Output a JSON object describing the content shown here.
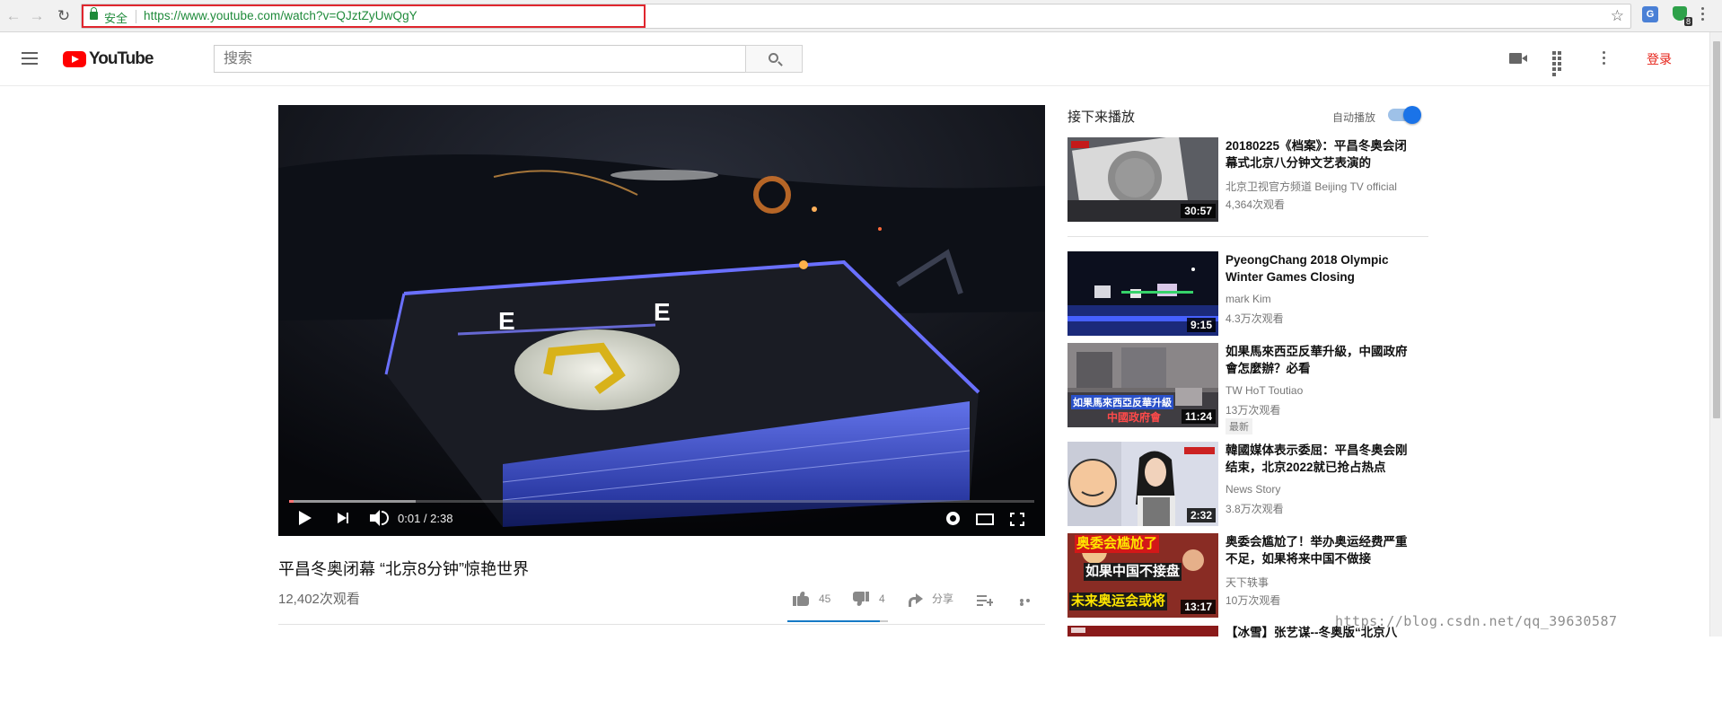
{
  "browser": {
    "secure_label": "安全",
    "url": "https://www.youtube.com/watch?v=QJztZyUwQgY",
    "extension_badge": "8"
  },
  "masthead": {
    "logo_text": "YouTube",
    "search_placeholder": "搜索",
    "signin_label": "登录"
  },
  "player": {
    "time": "0:01 / 2:38",
    "progress_played": 0.006,
    "progress_loaded": 0.17
  },
  "video": {
    "title": "平昌冬奥闭幕 “北京8分钟”惊艳世界",
    "views": "12,402次观看",
    "likes": "45",
    "dislikes": "4",
    "share_label": "分享",
    "like_ratio": 0.92
  },
  "sidebar": {
    "up_next_label": "接下来播放",
    "autoplay_label": "自动播放",
    "autoplay_on": true,
    "items": [
      {
        "title": "20180225《档案》：平昌冬奥会闭幕式北京八分钟文艺表演的",
        "channel": "北京卫视官方频道 Beijing TV official",
        "views": "4,364次观看",
        "duration": "30:57",
        "badge": ""
      },
      {
        "title": "PyeongChang 2018 Olympic Winter Games Closing",
        "channel": "mark Kim",
        "views": "4.3万次观看",
        "duration": "9:15",
        "badge": ""
      },
      {
        "title": "如果馬來西亞反華升級，中國政府會怎麼辦？必看",
        "channel": "TW HoT Toutiao",
        "views": "13万次观看",
        "duration": "11:24",
        "badge": "最新",
        "thumb_caption_1": "如果馬來西亞反華升級",
        "thumb_caption_2": "中國政府會"
      },
      {
        "title": "韓國媒体表示委屈：平昌冬奥会刚结束，北京2022就已抢占热点",
        "channel": "News Story",
        "views": "3.8万次观看",
        "duration": "2:32",
        "badge": ""
      },
      {
        "title": "奥委会尴尬了！举办奥运经费严重不足，如果将来中国不做接",
        "channel": "天下轶事",
        "views": "10万次观看",
        "duration": "13:17",
        "badge": "",
        "thumb_caption_1": "奥委会尴尬了",
        "thumb_caption_2": "如果中国不接盘",
        "thumb_caption_3": "未来奥运会或将"
      },
      {
        "title": "【冰雪】张艺谋--冬奥版“北京八",
        "channel": "",
        "views": "",
        "duration": "",
        "badge": ""
      }
    ]
  },
  "watermark": "https://blog.csdn.net/qq_39630587",
  "colors": {
    "youtube_red": "#ff0000",
    "signin_red": "#e62117",
    "secure_green": "#1e8a3a",
    "url_highlight_border": "#e0262e",
    "toggle_blue": "#1a73e8"
  },
  "icons": [
    "back-arrow-icon",
    "forward-arrow-icon",
    "reload-icon",
    "lock-icon",
    "star-icon",
    "translate-icon",
    "shield-extension-icon",
    "hamburger-icon",
    "search-icon",
    "upload-camera-icon",
    "apps-grid-icon",
    "more-vert-icon",
    "play-icon",
    "next-icon",
    "volume-icon",
    "settings-gear-icon",
    "theater-mode-icon",
    "fullscreen-icon",
    "thumbs-up-icon",
    "thumbs-down-icon",
    "share-icon",
    "add-to-playlist-icon",
    "more-horiz-icon"
  ]
}
